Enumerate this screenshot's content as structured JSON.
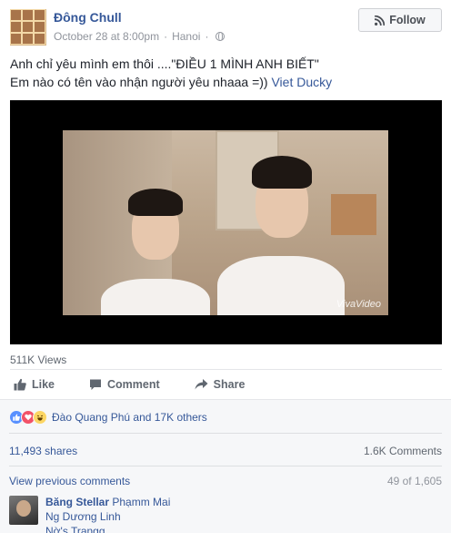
{
  "post": {
    "author": "Đông Chull",
    "date": "October 28 at 8:00pm",
    "location": "Hanoi",
    "follow_label": "Follow",
    "text_line1": "Anh chỉ yêu mình em thôi ....\"ĐIỀU 1 MÌNH ANH BIẾT\"",
    "text_line2_prefix": "Em nào có tên vào nhận người yêu nhaaa =)) ",
    "mention": "Viet Ducky"
  },
  "video": {
    "watermark": "VivaVideo",
    "views": "511K Views"
  },
  "actions": {
    "like": "Like",
    "comment": "Comment",
    "share": "Share"
  },
  "reactions": {
    "types": [
      "like",
      "love",
      "haha"
    ],
    "summary": "Đào Quang Phú and 17K others"
  },
  "stats": {
    "shares": "11,493 shares",
    "comments": "1.6K Comments"
  },
  "comments": {
    "view_previous": "View previous comments",
    "count": "49 of 1,605",
    "items": [
      {
        "author": "Băng Stellar",
        "tags": [
          "Phạmm Mai",
          "Ng Dương Linh",
          "Nờ's Trangg"
        ]
      }
    ]
  },
  "colors": {
    "link": "#365899",
    "muted": "#90949c",
    "like": "#5890ff",
    "love": "#f25268",
    "haha": "#fcd664"
  }
}
